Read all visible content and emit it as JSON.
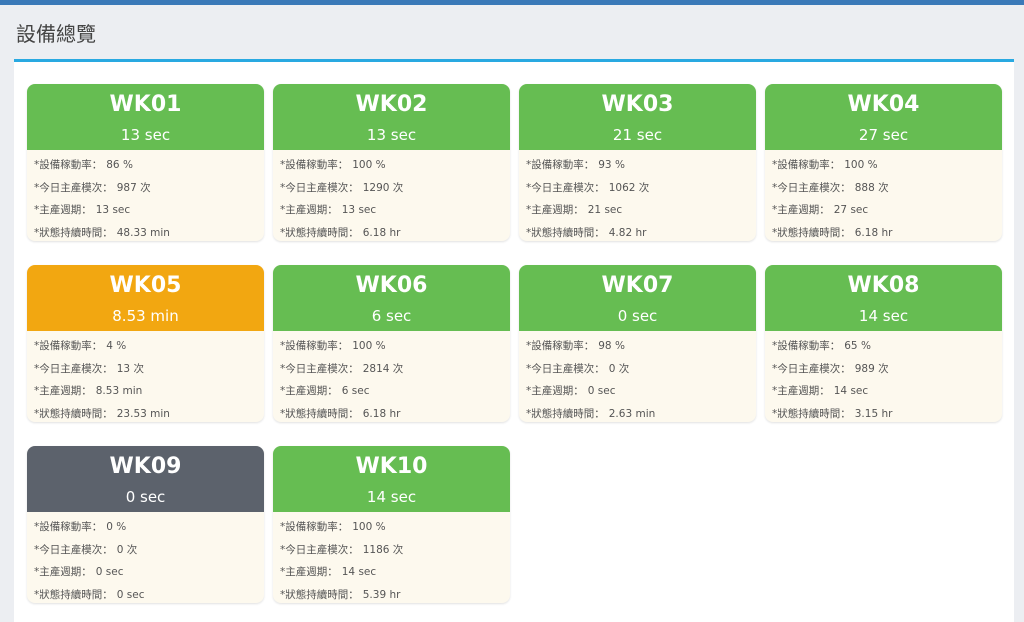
{
  "page": {
    "title": "設備總覽"
  },
  "colors": {
    "green": "#66bd52",
    "orange": "#f2a711",
    "gray": "#5c626c"
  },
  "labels": {
    "util": "*設備稼動率：",
    "count": "*今日主產模次：",
    "cycle": "*主產週期：",
    "duration": "*狀態持續時間："
  },
  "machines": [
    {
      "name": "WK01",
      "time": "13 sec",
      "status": "green",
      "util": "86 %",
      "count": "987 次",
      "cycle": "13 sec",
      "duration": "48.33 min"
    },
    {
      "name": "WK02",
      "time": "13 sec",
      "status": "green",
      "util": "100 %",
      "count": "1290 次",
      "cycle": "13 sec",
      "duration": "6.18 hr"
    },
    {
      "name": "WK03",
      "time": "21 sec",
      "status": "green",
      "util": "93 %",
      "count": "1062 次",
      "cycle": "21 sec",
      "duration": "4.82 hr"
    },
    {
      "name": "WK04",
      "time": "27 sec",
      "status": "green",
      "util": "100 %",
      "count": "888 次",
      "cycle": "27 sec",
      "duration": "6.18 hr"
    },
    {
      "name": "WK05",
      "time": "8.53 min",
      "status": "orange",
      "util": "4 %",
      "count": "13 次",
      "cycle": "8.53 min",
      "duration": "23.53 min"
    },
    {
      "name": "WK06",
      "time": "6 sec",
      "status": "green",
      "util": "100 %",
      "count": "2814 次",
      "cycle": "6 sec",
      "duration": "6.18 hr"
    },
    {
      "name": "WK07",
      "time": "0 sec",
      "status": "green",
      "util": "98 %",
      "count": "0 次",
      "cycle": "0 sec",
      "duration": "2.63 min"
    },
    {
      "name": "WK08",
      "time": "14 sec",
      "status": "green",
      "util": "65 %",
      "count": "989 次",
      "cycle": "14 sec",
      "duration": "3.15 hr"
    },
    {
      "name": "WK09",
      "time": "0 sec",
      "status": "gray",
      "util": "0 %",
      "count": "0 次",
      "cycle": "0 sec",
      "duration": "0 sec"
    },
    {
      "name": "WK10",
      "time": "14 sec",
      "status": "green",
      "util": "100 %",
      "count": "1186 次",
      "cycle": "14 sec",
      "duration": "5.39 hr"
    }
  ]
}
